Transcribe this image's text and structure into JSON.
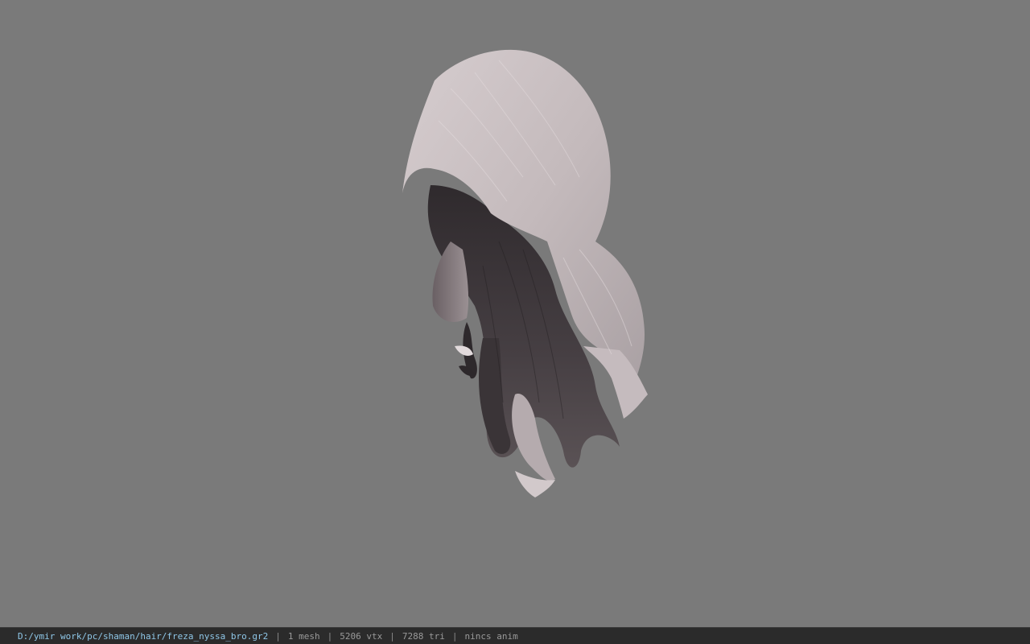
{
  "viewer": {
    "background_color": "#7a7a7a",
    "model_description": "hair mesh"
  },
  "status_bar": {
    "file_path": "D:/ymir work/pc/shaman/hair/freza_nyssa_bro.gr2",
    "separator": "|",
    "mesh_count": "1 mesh",
    "vertex_count": "5206 vtx",
    "triangle_count": "7288 tri",
    "animation_status": "nincs anim"
  },
  "colors": {
    "status_bar_bg": "#2b2b2b",
    "path_text": "#8fc7e8",
    "status_text": "#9a9a9a",
    "hair_light": "#c9bfc1",
    "hair_dark": "#3e383b"
  }
}
